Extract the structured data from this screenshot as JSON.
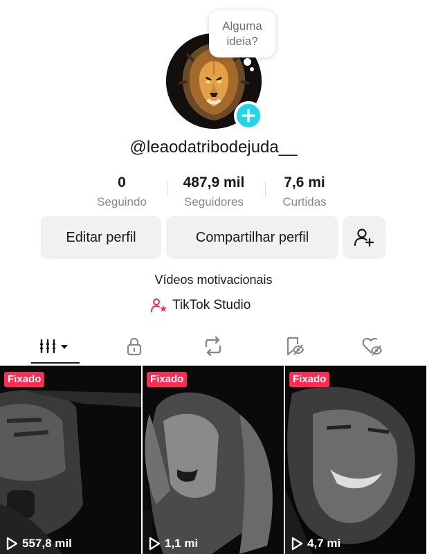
{
  "profile": {
    "username": "@leaodatribodejuda__",
    "bubble_line1": "Alguma",
    "bubble_line2": "ideia?",
    "bio": "Vídeos motivacionais",
    "studio_label": "TikTok Studio"
  },
  "stats": [
    {
      "value": "0",
      "label": "Seguindo"
    },
    {
      "value": "487,9 mil",
      "label": "Seguidores"
    },
    {
      "value": "7,6 mi",
      "label": "Curtidas"
    }
  ],
  "buttons": {
    "edit": "Editar perfil",
    "share": "Compartilhar perfil"
  },
  "tabs": [
    {
      "icon": "videos-grid-icon",
      "active": true
    },
    {
      "icon": "lock-icon",
      "active": false
    },
    {
      "icon": "repost-icon",
      "active": false
    },
    {
      "icon": "bookmark-icon",
      "active": false
    },
    {
      "icon": "liked-heart-icon",
      "active": false
    }
  ],
  "videos": [
    {
      "badge": "Fixado",
      "views": "557,8 mil"
    },
    {
      "badge": "Fixado",
      "views": "1,1 mi"
    },
    {
      "badge": "Fixado",
      "views": "4,7 mi"
    }
  ],
  "colors": {
    "accent_red": "#fe2c55",
    "add_badge": "#20d5ec",
    "text_primary": "#161823",
    "text_secondary": "#86878b",
    "button_bg": "#f1f1f2"
  }
}
